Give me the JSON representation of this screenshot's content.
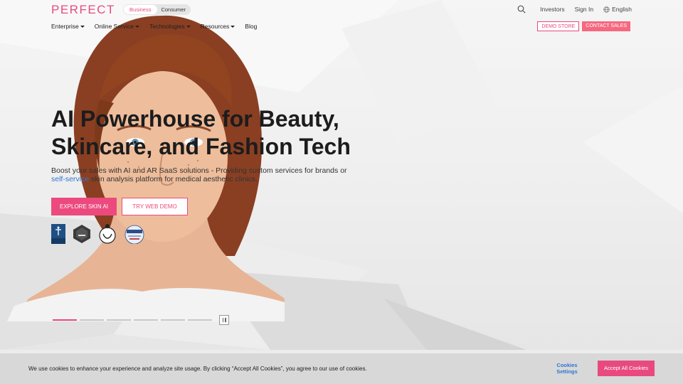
{
  "brand": {
    "logo": "PERFECT",
    "accent": "#e84a7f"
  },
  "toggle": {
    "business": "Business",
    "consumer": "Consumer"
  },
  "top_links": {
    "investors": "Investors",
    "sign_in": "Sign In",
    "language": "English"
  },
  "nav": {
    "items": [
      {
        "label": "Enterprise",
        "has_caret": true
      },
      {
        "label": "Online Service",
        "has_caret": true
      },
      {
        "label": "Technologies",
        "has_caret": true
      },
      {
        "label": "Resources",
        "has_caret": true
      },
      {
        "label": "Blog",
        "has_caret": false
      }
    ],
    "demo_store": "DEMO STORE",
    "contact_sales": "CONTACT SALES"
  },
  "hero": {
    "headline_line1": "AI Powerhouse for Beauty,",
    "headline_line2": "Skincare, and Fashion Tech",
    "sub_before": "Boost your sales with AI and AR SaaS solutions - Providing custom services for brands or ",
    "sub_link": "self-service",
    "sub_after": " skin analysis platform for medical aesthetic clinics.",
    "cta_primary": "EXPLORE SKIN AI",
    "cta_secondary": "TRY WEB DEMO",
    "badges": [
      "hipaa-badge",
      "doctors-badge",
      "bsi-badge",
      "anab-badge"
    ]
  },
  "carousel": {
    "slides": 6,
    "active_index": 0
  },
  "cookie": {
    "text": "We use cookies to enhance your experience and analyze site usage. By clicking “Accept All Cookies”, you agree to our use of cookies.",
    "settings_line1": "Cookies",
    "settings_line2": "Settings",
    "accept": "Accept All Cookies"
  }
}
